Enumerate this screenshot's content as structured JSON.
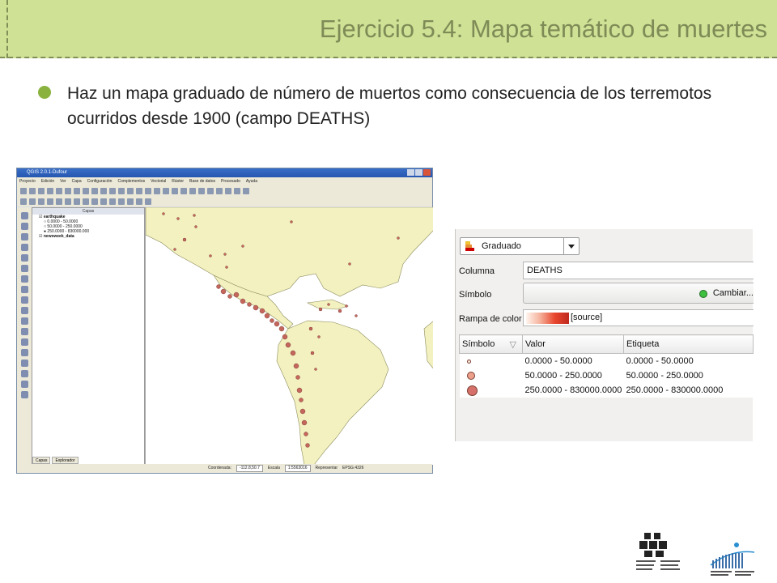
{
  "slide": {
    "title": "Ejercicio 5.4: Mapa temático de muertes",
    "bullet": "Haz un mapa graduado de número de muertos como consecuencia de los terremotos ocurridos desde 1900 (campo DEATHS)"
  },
  "qgis": {
    "window_title": "QGIS 2.0.1-Dufour",
    "menu": [
      "Proyecto",
      "Edición",
      "Ver",
      "Capa",
      "Configuración",
      "Complementos",
      "Vectorial",
      "Ráster",
      "Base de datos",
      "Procesado",
      "Ayuda"
    ],
    "layers_panel_title": "Capas",
    "layers": [
      {
        "name": "earthquake",
        "classes": [
          "0.0000 - 50.0000",
          "50.0000 - 250.0000",
          "250.0000 - 830000.000"
        ]
      },
      {
        "name": "newsweek_data",
        "classes": []
      }
    ],
    "panel_tabs": [
      "Capas",
      "Explorador"
    ],
    "status": {
      "coord_label": "Coordenada:",
      "coord_value": "-112.8,50.7",
      "scale_label": "Escala",
      "scale_value": "1:5563016",
      "render_label": "Representar",
      "crs": "EPSG:4326"
    }
  },
  "renderer": {
    "type": "Graduado",
    "column_label": "Columna",
    "column_value": "DEATHS",
    "symbol_label": "Símbolo",
    "change_button": "Cambiar...",
    "ramp_label": "Rampa de color",
    "ramp_value": "[source]",
    "table": {
      "headers": [
        "Símbolo",
        "Valor",
        "Etiqueta"
      ],
      "rows": [
        {
          "size": "small",
          "value": "0.0000 - 50.0000",
          "label": "0.0000 - 50.0000"
        },
        {
          "size": "medium",
          "value": "50.0000 - 250.0000",
          "label": "50.0000 - 250.0000"
        },
        {
          "size": "large",
          "value": "250.0000 - 830000.0000",
          "label": "250.0000 - 830000.0000"
        }
      ]
    }
  },
  "colors": {
    "banner": "#cfe195",
    "title": "#7e8b57",
    "bullet": "#89b33e",
    "land": "#f3f1c0",
    "point": "#c4665c"
  },
  "logos": {
    "upv": "Universidad del País Vasco / Euskal Herriko Unibertsitatea",
    "school": "Escuela Universitaria de Ingeniería Vitoria-Gasteiz"
  }
}
